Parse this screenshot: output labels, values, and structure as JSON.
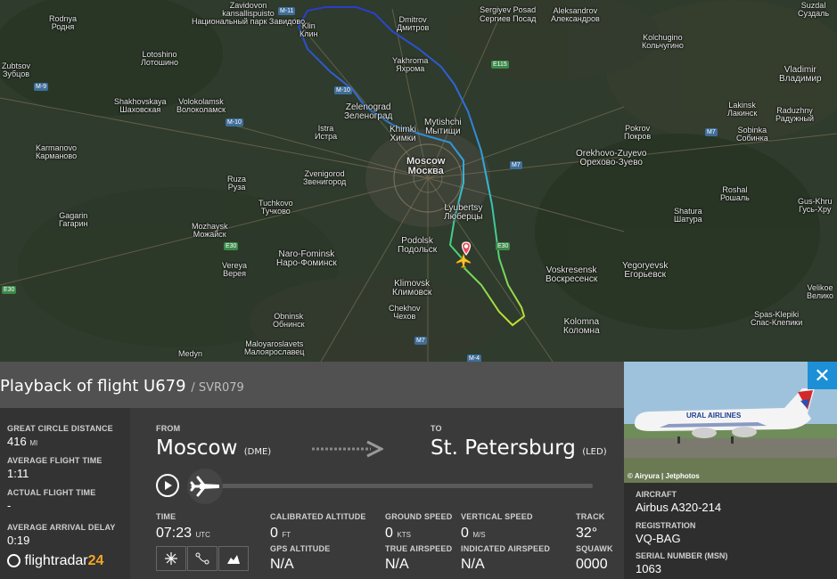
{
  "map": {
    "cities": [
      {
        "name": "Zavidovon",
        "ru": "kansallispuisto",
        "ru2": "Национальный парк Завидово"
      },
      {
        "name": "Rodnya",
        "ru": "Родня"
      },
      {
        "name": "Klin",
        "ru": "Клин"
      },
      {
        "name": "Dmitrov",
        "ru": "Дмитров"
      },
      {
        "name": "Sergiyev Posad",
        "ru": "Сергиев Посад"
      },
      {
        "name": "Aleksandrov",
        "ru": "Александров"
      },
      {
        "name": "Lotoshino",
        "ru": "Лотошино"
      },
      {
        "name": "Yakhroma",
        "ru": "Яхрома"
      },
      {
        "name": "Kolchugino",
        "ru": "Кольчугино"
      },
      {
        "name": "Zubtsov",
        "ru": "Зубцов"
      },
      {
        "name": "Shakhovskaya",
        "ru": "Шаховская"
      },
      {
        "name": "Volokolamsk",
        "ru": "Волоколамск"
      },
      {
        "name": "Zelenograd",
        "ru": "Зеленоград"
      },
      {
        "name": "Vladimir",
        "ru": "Владимир"
      },
      {
        "name": "Suzdal",
        "ru": "Суздаль"
      },
      {
        "name": "Istra",
        "ru": "Истра"
      },
      {
        "name": "Mytishchi",
        "ru": "Мытищи"
      },
      {
        "name": "Khimki",
        "ru": "Химки"
      },
      {
        "name": "Lakinsk",
        "ru": "Лакинск"
      },
      {
        "name": "Raduzhny",
        "ru": "Радужный"
      },
      {
        "name": "Karmanovo",
        "ru": "Карманово"
      },
      {
        "name": "Pokrov",
        "ru": "Покров"
      },
      {
        "name": "Orekhovo-Zuyevo",
        "ru": "Орехово-Зуево"
      },
      {
        "name": "Sobinka",
        "ru": "Собинка"
      },
      {
        "name": "Moscow",
        "ru": "Москва"
      },
      {
        "name": "Zvenigorod",
        "ru": "Звенигород"
      },
      {
        "name": "Ruza",
        "ru": "Руза"
      },
      {
        "name": "Tuchkovo",
        "ru": "Тучково"
      },
      {
        "name": "Lyubertsy",
        "ru": "Люберцы"
      },
      {
        "name": "Roshal",
        "ru": "Рошаль"
      },
      {
        "name": "Gus-Khru",
        "ru": "Гусь-Хру"
      },
      {
        "name": "Gagarin",
        "ru": "Гагарин"
      },
      {
        "name": "Shatura",
        "ru": "Шатура"
      },
      {
        "name": "Mozhaysk",
        "ru": "Можайск"
      },
      {
        "name": "Podolsk",
        "ru": "Подольск"
      },
      {
        "name": "Naro-Fominsk",
        "ru": "Наро-Фоминск"
      },
      {
        "name": "Voskresensk",
        "ru": "Воскресенск"
      },
      {
        "name": "Yegoryevsk",
        "ru": "Егорьевск"
      },
      {
        "name": "Vereya",
        "ru": "Верея"
      },
      {
        "name": "Klimovsk",
        "ru": "Климовск"
      },
      {
        "name": "Velikoe",
        "ru": "Велико"
      },
      {
        "name": "Chekhov",
        "ru": "Чехов"
      },
      {
        "name": "Obninsk",
        "ru": "Обнинск"
      },
      {
        "name": "Kolomna",
        "ru": "Коломна"
      },
      {
        "name": "Spas-Klepiki",
        "ru": "Спас-Клепики"
      },
      {
        "name": "Maloyaroslavets",
        "ru": "Малоярославец"
      },
      {
        "name": "Medyn",
        "ru": "Медынь"
      }
    ],
    "roads": [
      "M-11",
      "M-9",
      "M-10",
      "E115",
      "M-10",
      "M7",
      "M7",
      "M-9",
      "E30",
      "E30",
      "M-4",
      "M-1",
      "E30",
      "M7",
      "M-4"
    ]
  },
  "panel": {
    "title": "Playback of flight U679",
    "callsign": "/ SVR079",
    "great_circle_label": "GREAT CIRCLE DISTANCE",
    "great_circle_value": "416",
    "great_circle_unit": "MI",
    "avg_time_label": "AVERAGE FLIGHT TIME",
    "avg_time_value": "1:11",
    "actual_time_label": "ACTUAL FLIGHT TIME",
    "actual_time_value": "-",
    "avg_delay_label": "AVERAGE ARRIVAL DELAY",
    "avg_delay_value": "0:19",
    "logo_text": "flightradar",
    "logo_num": "24",
    "from_label": "FROM",
    "from_city": "Moscow",
    "from_iata": "(DME)",
    "to_label": "TO",
    "to_city": "St. Petersburg",
    "to_iata": "(LED)",
    "time_label": "TIME",
    "time_value": "07:23",
    "time_unit": "UTC",
    "cal_alt_label": "CALIBRATED ALTITUDE",
    "cal_alt_value": "0",
    "cal_alt_unit": "FT",
    "gps_alt_label": "GPS ALTITUDE",
    "gps_alt_value": "N/A",
    "ground_speed_label": "GROUND SPEED",
    "ground_speed_value": "0",
    "ground_speed_unit": "KTS",
    "true_airspeed_label": "TRUE AIRSPEED",
    "true_airspeed_value": "N/A",
    "vertical_speed_label": "VERTICAL SPEED",
    "vertical_speed_value": "0",
    "vertical_speed_unit": "M/S",
    "indicated_airspeed_label": "INDICATED AIRSPEED",
    "indicated_airspeed_value": "N/A",
    "track_label": "TRACK",
    "track_value": "32°",
    "squawk_label": "SQUAWK",
    "squawk_value": "0000",
    "progress": 0.0
  },
  "side": {
    "close": "✕",
    "photo_credit": "© Airyura | Jetphotos",
    "aircraft_label": "AIRCRAFT",
    "aircraft_value": "Airbus A320-214",
    "registration_label": "REGISTRATION",
    "registration_value": "VQ-BAG",
    "serial_label": "SERIAL NUMBER (MSN)",
    "serial_value": "1063",
    "airline_livery_text": "URAL AIRLINES"
  }
}
